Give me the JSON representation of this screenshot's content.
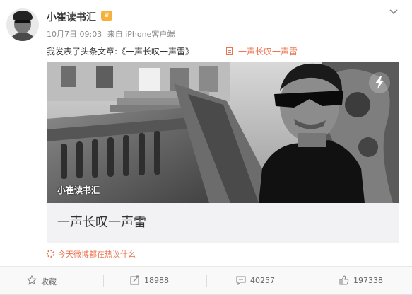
{
  "author": {
    "name": "小崔读书汇",
    "badge_icon": "member-crown-icon"
  },
  "meta": {
    "date": "10月7日 09:03",
    "source": "来自 iPhone客户端"
  },
  "post": {
    "text": "我发表了头条文章:《一声长叹一声雷》",
    "article_link": "一声长叹一声雷"
  },
  "card": {
    "watermark": "小崔读书汇",
    "title": "一声长叹一声雷",
    "badge_icon": "lightning-icon"
  },
  "hot_topic": "今天微博都在热议什么",
  "toolbar": {
    "favorite_label": "收藏",
    "share_count": "18988",
    "comment_count": "40257",
    "like_count": "197338"
  },
  "colors": {
    "accent": "#eb7350",
    "badge": "#f7b038",
    "text_secondary": "#888888"
  }
}
